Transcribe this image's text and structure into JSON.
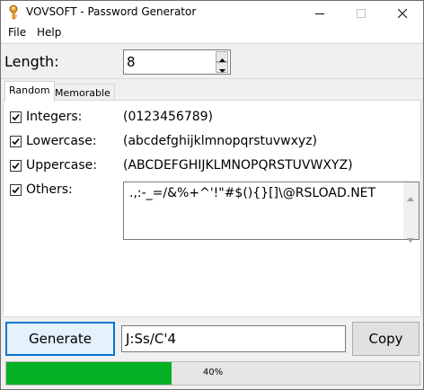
{
  "window": {
    "title": "VOVSOFT - Password Generator",
    "icons": {
      "app": "key-icon",
      "minimize": "minimize-icon",
      "maximize": "maximize-icon",
      "close": "close-icon"
    }
  },
  "menu": {
    "items": [
      "File",
      "Help"
    ]
  },
  "length": {
    "label": "Length:",
    "value": "8"
  },
  "tabs": [
    {
      "label": "Random",
      "active": true
    },
    {
      "label": "Memorable",
      "active": false
    }
  ],
  "options": [
    {
      "label": "Integers:",
      "checked": true,
      "chars": "(0123456789)"
    },
    {
      "label": "Lowercase:",
      "checked": true,
      "chars": "(abcdefghijklmnopqrstuvwxyz)"
    },
    {
      "label": "Uppercase:",
      "checked": true,
      "chars": "(ABCDEFGHIJKLMNOPQRSTUVWXYZ)"
    },
    {
      "label": "Others:",
      "checked": true,
      "chars": ".,:-_=/&%+^'!\"#$(){}[]\\@RSLOAD.NET"
    }
  ],
  "actions": {
    "generate_label": "Generate",
    "copy_label": "Copy"
  },
  "password": {
    "value": "J:Ss/C'4"
  },
  "progress": {
    "percent": 40,
    "label": "40%",
    "color": "#06b025"
  },
  "colors": {
    "accent": "#0078d7"
  }
}
